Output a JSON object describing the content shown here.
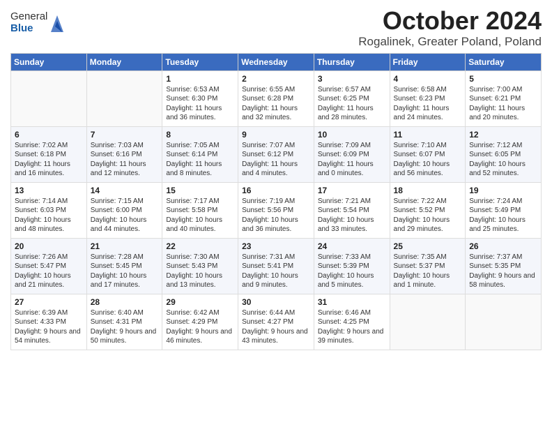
{
  "header": {
    "logo_general": "General",
    "logo_blue": "Blue",
    "month_title": "October 2024",
    "location": "Rogalinek, Greater Poland, Poland"
  },
  "days_of_week": [
    "Sunday",
    "Monday",
    "Tuesday",
    "Wednesday",
    "Thursday",
    "Friday",
    "Saturday"
  ],
  "weeks": [
    [
      {
        "day": "",
        "empty": true
      },
      {
        "day": "",
        "empty": true
      },
      {
        "day": "1",
        "sunrise": "Sunrise: 6:53 AM",
        "sunset": "Sunset: 6:30 PM",
        "daylight": "Daylight: 11 hours and 36 minutes."
      },
      {
        "day": "2",
        "sunrise": "Sunrise: 6:55 AM",
        "sunset": "Sunset: 6:28 PM",
        "daylight": "Daylight: 11 hours and 32 minutes."
      },
      {
        "day": "3",
        "sunrise": "Sunrise: 6:57 AM",
        "sunset": "Sunset: 6:25 PM",
        "daylight": "Daylight: 11 hours and 28 minutes."
      },
      {
        "day": "4",
        "sunrise": "Sunrise: 6:58 AM",
        "sunset": "Sunset: 6:23 PM",
        "daylight": "Daylight: 11 hours and 24 minutes."
      },
      {
        "day": "5",
        "sunrise": "Sunrise: 7:00 AM",
        "sunset": "Sunset: 6:21 PM",
        "daylight": "Daylight: 11 hours and 20 minutes."
      }
    ],
    [
      {
        "day": "6",
        "sunrise": "Sunrise: 7:02 AM",
        "sunset": "Sunset: 6:18 PM",
        "daylight": "Daylight: 11 hours and 16 minutes."
      },
      {
        "day": "7",
        "sunrise": "Sunrise: 7:03 AM",
        "sunset": "Sunset: 6:16 PM",
        "daylight": "Daylight: 11 hours and 12 minutes."
      },
      {
        "day": "8",
        "sunrise": "Sunrise: 7:05 AM",
        "sunset": "Sunset: 6:14 PM",
        "daylight": "Daylight: 11 hours and 8 minutes."
      },
      {
        "day": "9",
        "sunrise": "Sunrise: 7:07 AM",
        "sunset": "Sunset: 6:12 PM",
        "daylight": "Daylight: 11 hours and 4 minutes."
      },
      {
        "day": "10",
        "sunrise": "Sunrise: 7:09 AM",
        "sunset": "Sunset: 6:09 PM",
        "daylight": "Daylight: 11 hours and 0 minutes."
      },
      {
        "day": "11",
        "sunrise": "Sunrise: 7:10 AM",
        "sunset": "Sunset: 6:07 PM",
        "daylight": "Daylight: 10 hours and 56 minutes."
      },
      {
        "day": "12",
        "sunrise": "Sunrise: 7:12 AM",
        "sunset": "Sunset: 6:05 PM",
        "daylight": "Daylight: 10 hours and 52 minutes."
      }
    ],
    [
      {
        "day": "13",
        "sunrise": "Sunrise: 7:14 AM",
        "sunset": "Sunset: 6:03 PM",
        "daylight": "Daylight: 10 hours and 48 minutes."
      },
      {
        "day": "14",
        "sunrise": "Sunrise: 7:15 AM",
        "sunset": "Sunset: 6:00 PM",
        "daylight": "Daylight: 10 hours and 44 minutes."
      },
      {
        "day": "15",
        "sunrise": "Sunrise: 7:17 AM",
        "sunset": "Sunset: 5:58 PM",
        "daylight": "Daylight: 10 hours and 40 minutes."
      },
      {
        "day": "16",
        "sunrise": "Sunrise: 7:19 AM",
        "sunset": "Sunset: 5:56 PM",
        "daylight": "Daylight: 10 hours and 36 minutes."
      },
      {
        "day": "17",
        "sunrise": "Sunrise: 7:21 AM",
        "sunset": "Sunset: 5:54 PM",
        "daylight": "Daylight: 10 hours and 33 minutes."
      },
      {
        "day": "18",
        "sunrise": "Sunrise: 7:22 AM",
        "sunset": "Sunset: 5:52 PM",
        "daylight": "Daylight: 10 hours and 29 minutes."
      },
      {
        "day": "19",
        "sunrise": "Sunrise: 7:24 AM",
        "sunset": "Sunset: 5:49 PM",
        "daylight": "Daylight: 10 hours and 25 minutes."
      }
    ],
    [
      {
        "day": "20",
        "sunrise": "Sunrise: 7:26 AM",
        "sunset": "Sunset: 5:47 PM",
        "daylight": "Daylight: 10 hours and 21 minutes."
      },
      {
        "day": "21",
        "sunrise": "Sunrise: 7:28 AM",
        "sunset": "Sunset: 5:45 PM",
        "daylight": "Daylight: 10 hours and 17 minutes."
      },
      {
        "day": "22",
        "sunrise": "Sunrise: 7:30 AM",
        "sunset": "Sunset: 5:43 PM",
        "daylight": "Daylight: 10 hours and 13 minutes."
      },
      {
        "day": "23",
        "sunrise": "Sunrise: 7:31 AM",
        "sunset": "Sunset: 5:41 PM",
        "daylight": "Daylight: 10 hours and 9 minutes."
      },
      {
        "day": "24",
        "sunrise": "Sunrise: 7:33 AM",
        "sunset": "Sunset: 5:39 PM",
        "daylight": "Daylight: 10 hours and 5 minutes."
      },
      {
        "day": "25",
        "sunrise": "Sunrise: 7:35 AM",
        "sunset": "Sunset: 5:37 PM",
        "daylight": "Daylight: 10 hours and 1 minute."
      },
      {
        "day": "26",
        "sunrise": "Sunrise: 7:37 AM",
        "sunset": "Sunset: 5:35 PM",
        "daylight": "Daylight: 9 hours and 58 minutes."
      }
    ],
    [
      {
        "day": "27",
        "sunrise": "Sunrise: 6:39 AM",
        "sunset": "Sunset: 4:33 PM",
        "daylight": "Daylight: 9 hours and 54 minutes."
      },
      {
        "day": "28",
        "sunrise": "Sunrise: 6:40 AM",
        "sunset": "Sunset: 4:31 PM",
        "daylight": "Daylight: 9 hours and 50 minutes."
      },
      {
        "day": "29",
        "sunrise": "Sunrise: 6:42 AM",
        "sunset": "Sunset: 4:29 PM",
        "daylight": "Daylight: 9 hours and 46 minutes."
      },
      {
        "day": "30",
        "sunrise": "Sunrise: 6:44 AM",
        "sunset": "Sunset: 4:27 PM",
        "daylight": "Daylight: 9 hours and 43 minutes."
      },
      {
        "day": "31",
        "sunrise": "Sunrise: 6:46 AM",
        "sunset": "Sunset: 4:25 PM",
        "daylight": "Daylight: 9 hours and 39 minutes."
      },
      {
        "day": "",
        "empty": true
      },
      {
        "day": "",
        "empty": true
      }
    ]
  ]
}
